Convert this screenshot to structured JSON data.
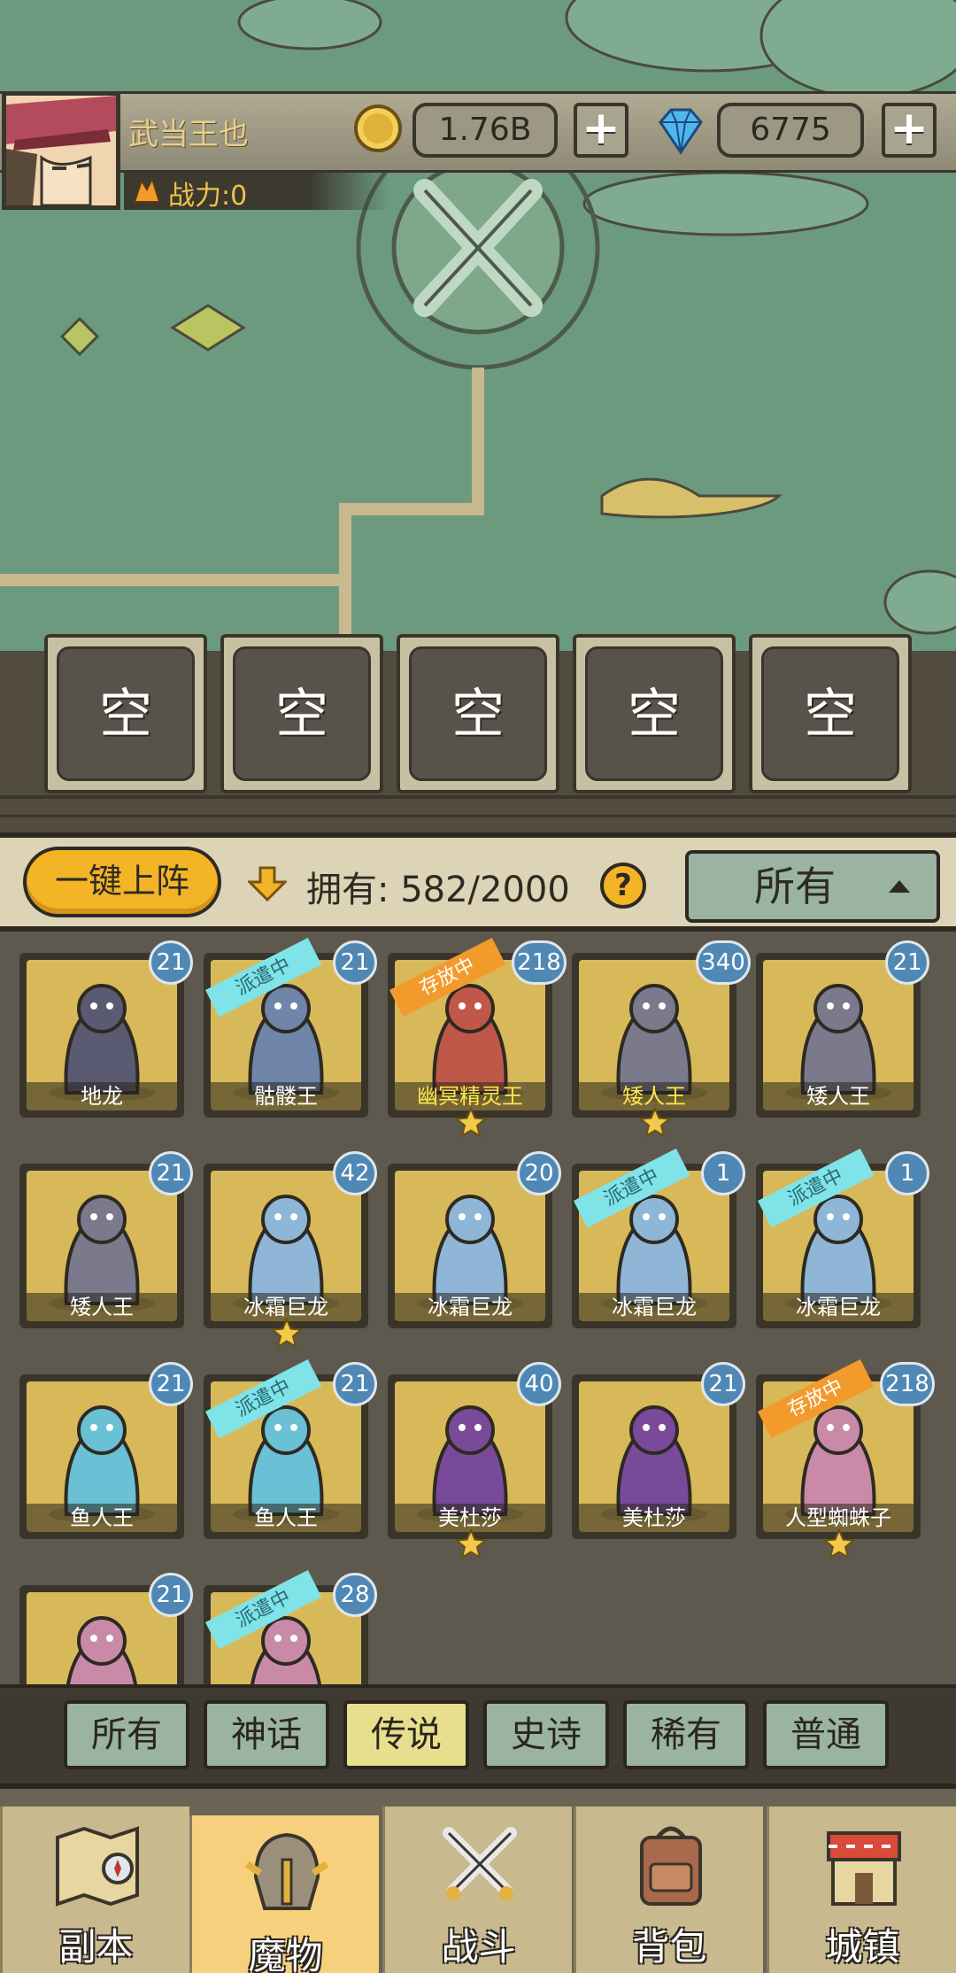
{
  "player": {
    "name": "武当王也",
    "power": "战力:0"
  },
  "currency": {
    "gold": "1.76B",
    "gems": "6775",
    "plus": "+"
  },
  "slots": [
    "空",
    "空",
    "空",
    "空",
    "空"
  ],
  "toolbar": {
    "deploy_label": "一键上阵",
    "own_label": "拥有:",
    "own_count": "582/2000",
    "help": "?",
    "sort_selected": "所有"
  },
  "monsters": [
    {
      "name": "地龙",
      "level": "21",
      "status": "",
      "stars": 0,
      "gold_name": false
    },
    {
      "name": "骷髅王",
      "level": "21",
      "status": "派遣中",
      "stars": 0,
      "gold_name": false
    },
    {
      "name": "幽冥精灵王",
      "level": "218",
      "status": "存放中",
      "stars": 1,
      "gold_name": true
    },
    {
      "name": "矮人王",
      "level": "340",
      "status": "",
      "stars": 1,
      "gold_name": true
    },
    {
      "name": "矮人王",
      "level": "21",
      "status": "",
      "stars": 0,
      "gold_name": false
    },
    {
      "name": "矮人王",
      "level": "21",
      "status": "",
      "stars": 0,
      "gold_name": false
    },
    {
      "name": "冰霜巨龙",
      "level": "42",
      "status": "",
      "stars": 1,
      "gold_name": false
    },
    {
      "name": "冰霜巨龙",
      "level": "20",
      "status": "",
      "stars": 0,
      "gold_name": false
    },
    {
      "name": "冰霜巨龙",
      "level": "1",
      "status": "派遣中",
      "stars": 0,
      "gold_name": false
    },
    {
      "name": "冰霜巨龙",
      "level": "1",
      "status": "派遣中",
      "stars": 0,
      "gold_name": false
    },
    {
      "name": "鱼人王",
      "level": "21",
      "status": "",
      "stars": 0,
      "gold_name": false
    },
    {
      "name": "鱼人王",
      "level": "21",
      "status": "派遣中",
      "stars": 0,
      "gold_name": false
    },
    {
      "name": "美杜莎",
      "level": "40",
      "status": "",
      "stars": 1,
      "gold_name": false
    },
    {
      "name": "美杜莎",
      "level": "21",
      "status": "",
      "stars": 0,
      "gold_name": false
    },
    {
      "name": "人型蜘蛛子",
      "level": "218",
      "status": "存放中",
      "stars": 1,
      "gold_name": false
    },
    {
      "name": "",
      "level": "21",
      "status": "",
      "stars": 0,
      "gold_name": false
    },
    {
      "name": "",
      "level": "28",
      "status": "派遣中",
      "stars": 0,
      "gold_name": false
    }
  ],
  "rarity_tabs": [
    "所有",
    "神话",
    "传说",
    "史诗",
    "稀有",
    "普通"
  ],
  "rarity_active": "传说",
  "nav": [
    "副本",
    "魔物",
    "战斗",
    "背包",
    "城镇"
  ],
  "nav_active": "魔物",
  "colors": {
    "accent": "#f3b526",
    "map": "#6c9a7f",
    "badge": "#4f88b5",
    "ribbon_dispatch": "#7fe3e8",
    "ribbon_stored": "#f39a2c"
  }
}
